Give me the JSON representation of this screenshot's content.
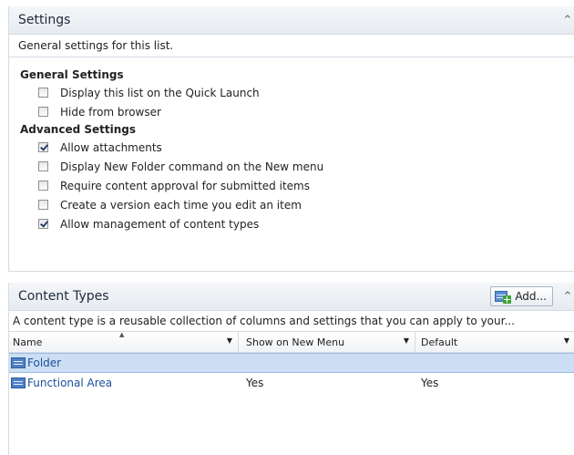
{
  "settings": {
    "title": "Settings",
    "description": "General settings for this list.",
    "general": {
      "label": "General Settings",
      "items": [
        {
          "label": "Display this list on the Quick Launch",
          "checked": false
        },
        {
          "label": "Hide from browser",
          "checked": false
        }
      ]
    },
    "advanced": {
      "label": "Advanced Settings",
      "items": [
        {
          "label": "Allow attachments",
          "checked": true
        },
        {
          "label": "Display New Folder command on the New menu",
          "checked": false
        },
        {
          "label": "Require content approval for submitted items",
          "checked": false
        },
        {
          "label": "Create a version each time you edit an item",
          "checked": false
        },
        {
          "label": "Allow management of content types",
          "checked": true
        }
      ]
    }
  },
  "content_types": {
    "title": "Content Types",
    "add_label": "Add...",
    "description": "A content type is a reusable collection of columns and settings that you can apply to your...",
    "columns": {
      "name": "Name",
      "show": "Show on New Menu",
      "default": "Default"
    },
    "rows": [
      {
        "name": "Folder",
        "show": "",
        "default": "",
        "selected": true
      },
      {
        "name": "Functional Area",
        "show": "Yes",
        "default": "Yes",
        "selected": false
      }
    ]
  },
  "colors": {
    "link": "#1b4f9c",
    "selection": "#ccdef3",
    "border": "#d5dbe3"
  },
  "icons": {
    "collapse": "chevron-up-icon",
    "add": "add-content-type-icon",
    "content_type": "content-type-icon",
    "dropdown": "dropdown-arrow-icon",
    "sort": "sort-ascending-icon"
  }
}
